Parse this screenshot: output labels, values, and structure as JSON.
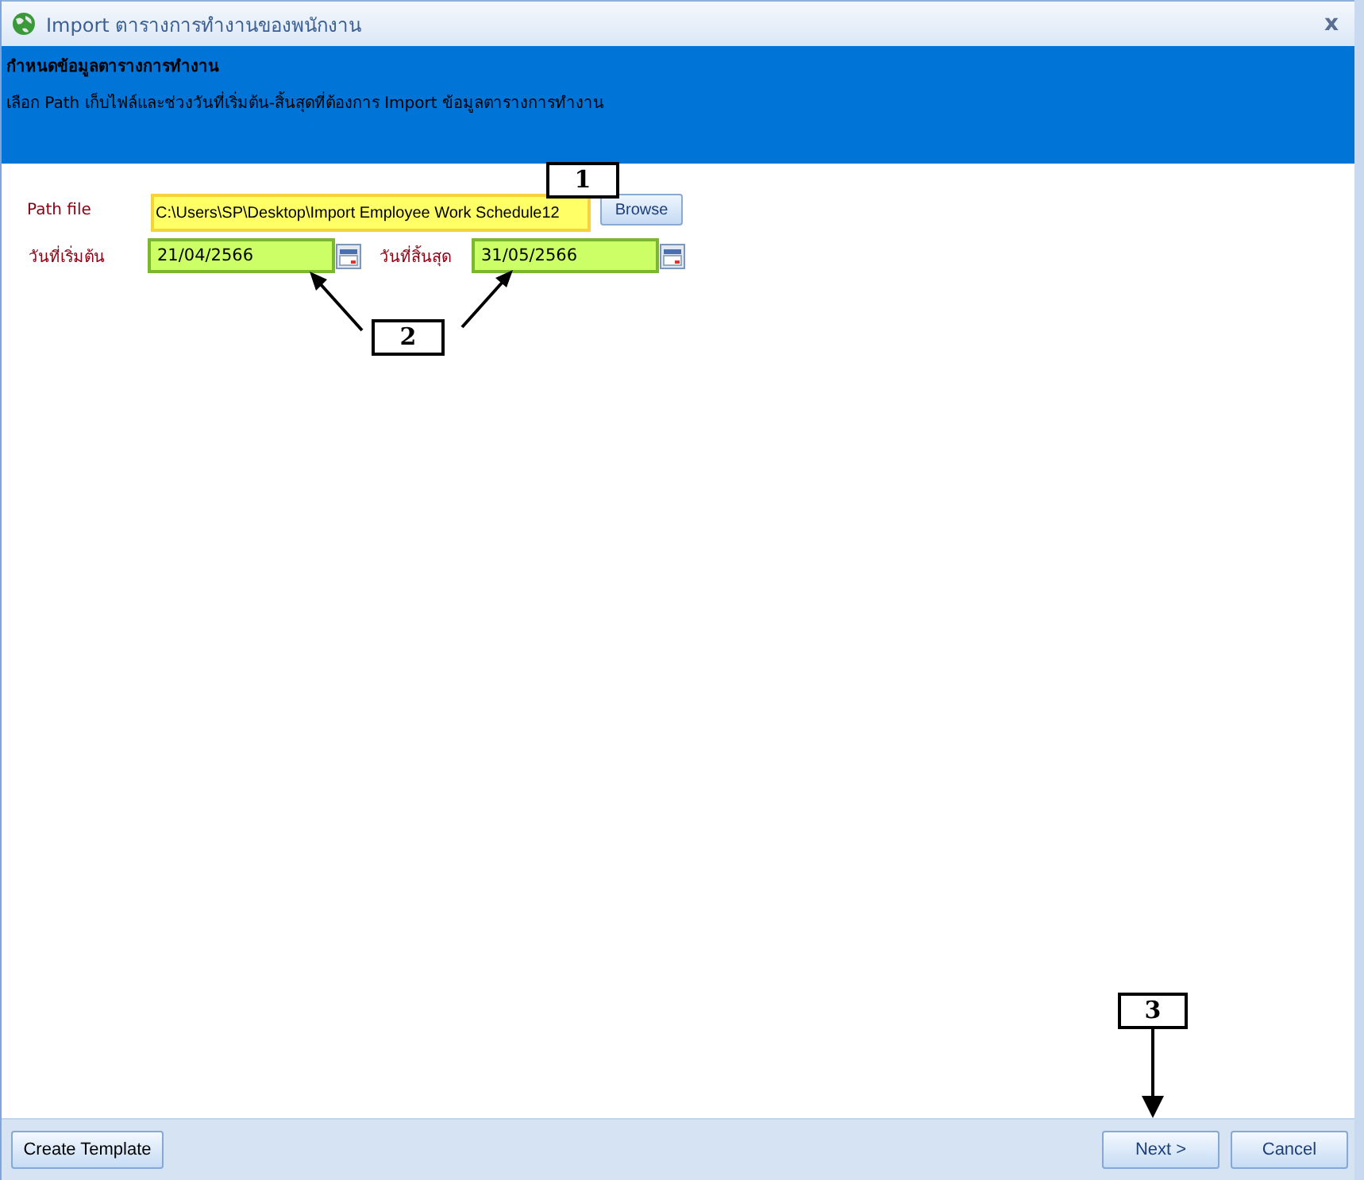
{
  "window": {
    "title": "Import ตารางการทำงานของพนักงาน",
    "close": "x"
  },
  "header": {
    "title": "กำหนดข้อมูลตารางการทำงาน",
    "description": "เลือก Path เก็บไฟล์และช่วงวันที่เริ่มต้น-สิ้นสุดที่ต้องการ Import ข้อมูลตารางการทำงาน"
  },
  "path_field": {
    "label": "Path file",
    "value": "C:\\Users\\SP\\Desktop\\Import Employee Work Schedule12",
    "button": "Browse"
  },
  "date_fields": [
    {
      "label": "วันที่เริ่มต้น",
      "value": "21/04/2566"
    },
    {
      "label": "วันที่สิ้นสุด",
      "value": "31/05/2566"
    }
  ],
  "footer": {
    "left_button": "Create Template",
    "right_buttons": [
      "Next >",
      "Cancel"
    ]
  },
  "callouts": [
    "1",
    "2",
    "3"
  ]
}
